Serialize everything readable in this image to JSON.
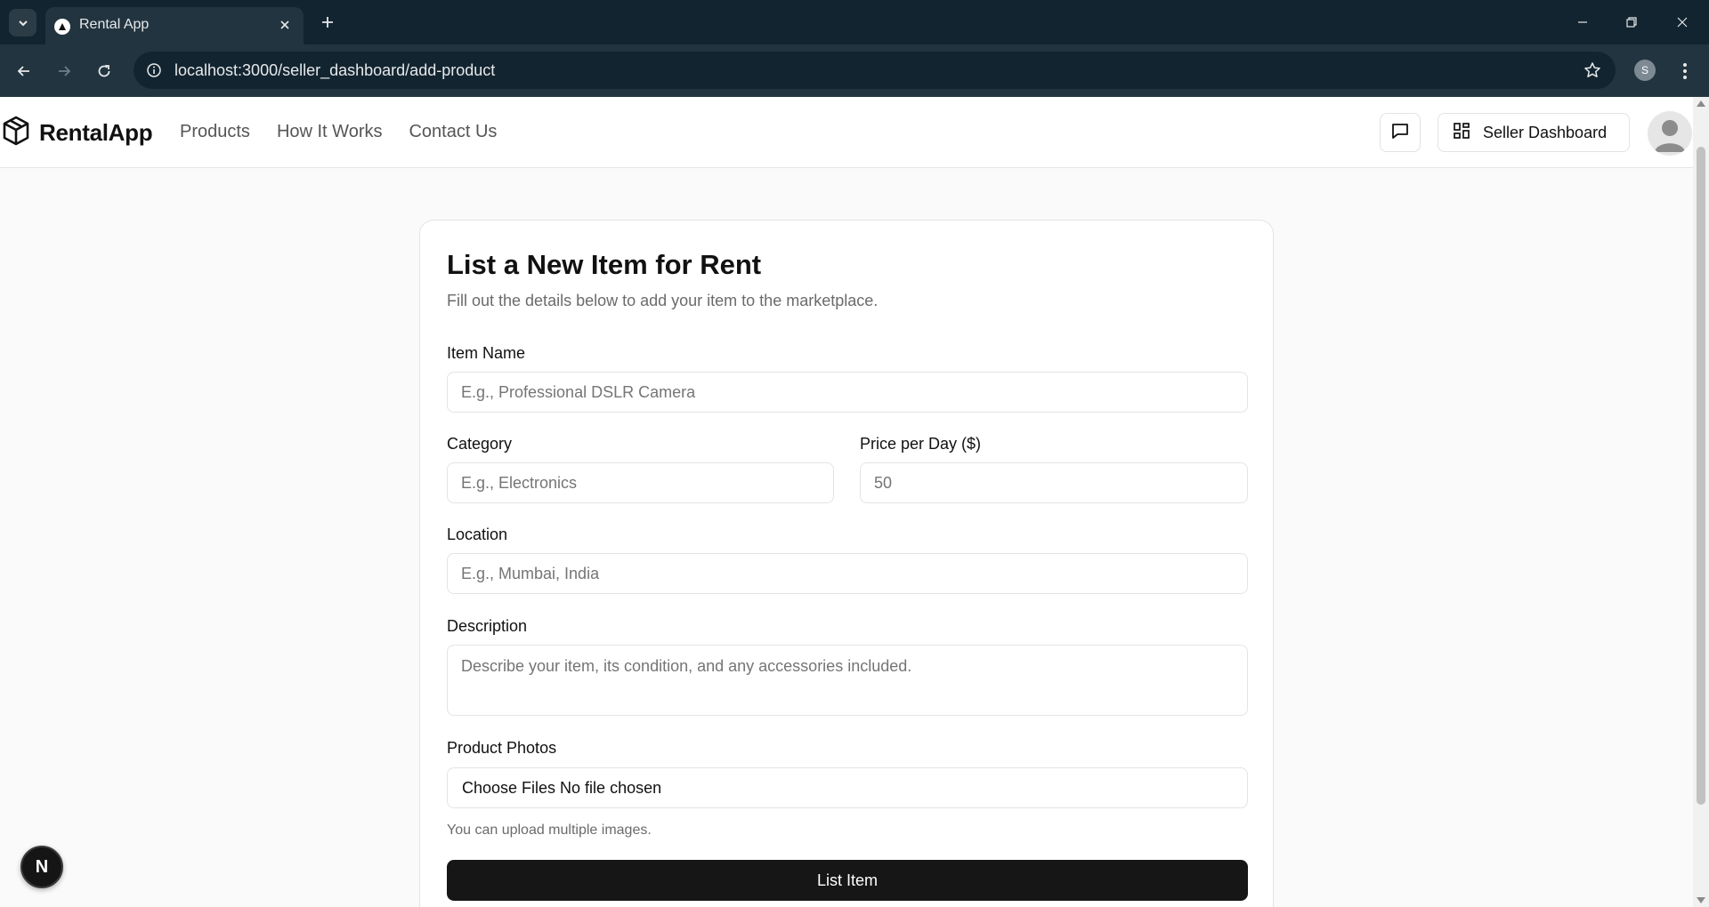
{
  "browser": {
    "tab_title": "Rental App",
    "url": "localhost:3000/seller_dashboard/add-product",
    "profile_initial": "S",
    "icons": [
      "tab-list-icon",
      "favicon-triangle-icon",
      "close-icon",
      "plus-icon",
      "minimize-icon",
      "restore-icon",
      "window-close-icon",
      "back-arrow-icon",
      "forward-arrow-icon",
      "reload-icon",
      "info-icon",
      "star-icon",
      "kebab-menu-icon"
    ]
  },
  "header": {
    "logo_text": "RentalApp",
    "nav": [
      {
        "label": "Products"
      },
      {
        "label": "How It Works"
      },
      {
        "label": "Contact Us"
      }
    ],
    "dashboard_label": "Seller Dashboard",
    "icons": [
      "package-icon",
      "message-square-icon",
      "dashboard-grid-icon",
      "user-avatar-icon"
    ]
  },
  "form": {
    "title": "List a New Item for Rent",
    "subtitle": "Fill out the details below to add your item to the marketplace.",
    "item_name": {
      "label": "Item Name",
      "placeholder": "E.g., Professional DSLR Camera",
      "value": ""
    },
    "category": {
      "label": "Category",
      "placeholder": "E.g., Electronics",
      "value": ""
    },
    "price": {
      "label": "Price per Day ($)",
      "placeholder": "50",
      "value": ""
    },
    "location": {
      "label": "Location",
      "placeholder": "E.g., Mumbai, India",
      "value": ""
    },
    "description": {
      "label": "Description",
      "placeholder": "Describe your item, its condition, and any accessories included.",
      "value": ""
    },
    "photos": {
      "label": "Product Photos",
      "button": "Choose Files",
      "status": "No file chosen",
      "hint": "You can upload multiple images."
    },
    "submit_label": "List Item"
  },
  "dev_badge": {
    "label": "N"
  },
  "colors": {
    "chrome_dark": "#12242f",
    "chrome_toolbar": "#22343f",
    "page_bg": "#fafafa",
    "primary_button": "#161616",
    "border": "#e4e4e7"
  }
}
